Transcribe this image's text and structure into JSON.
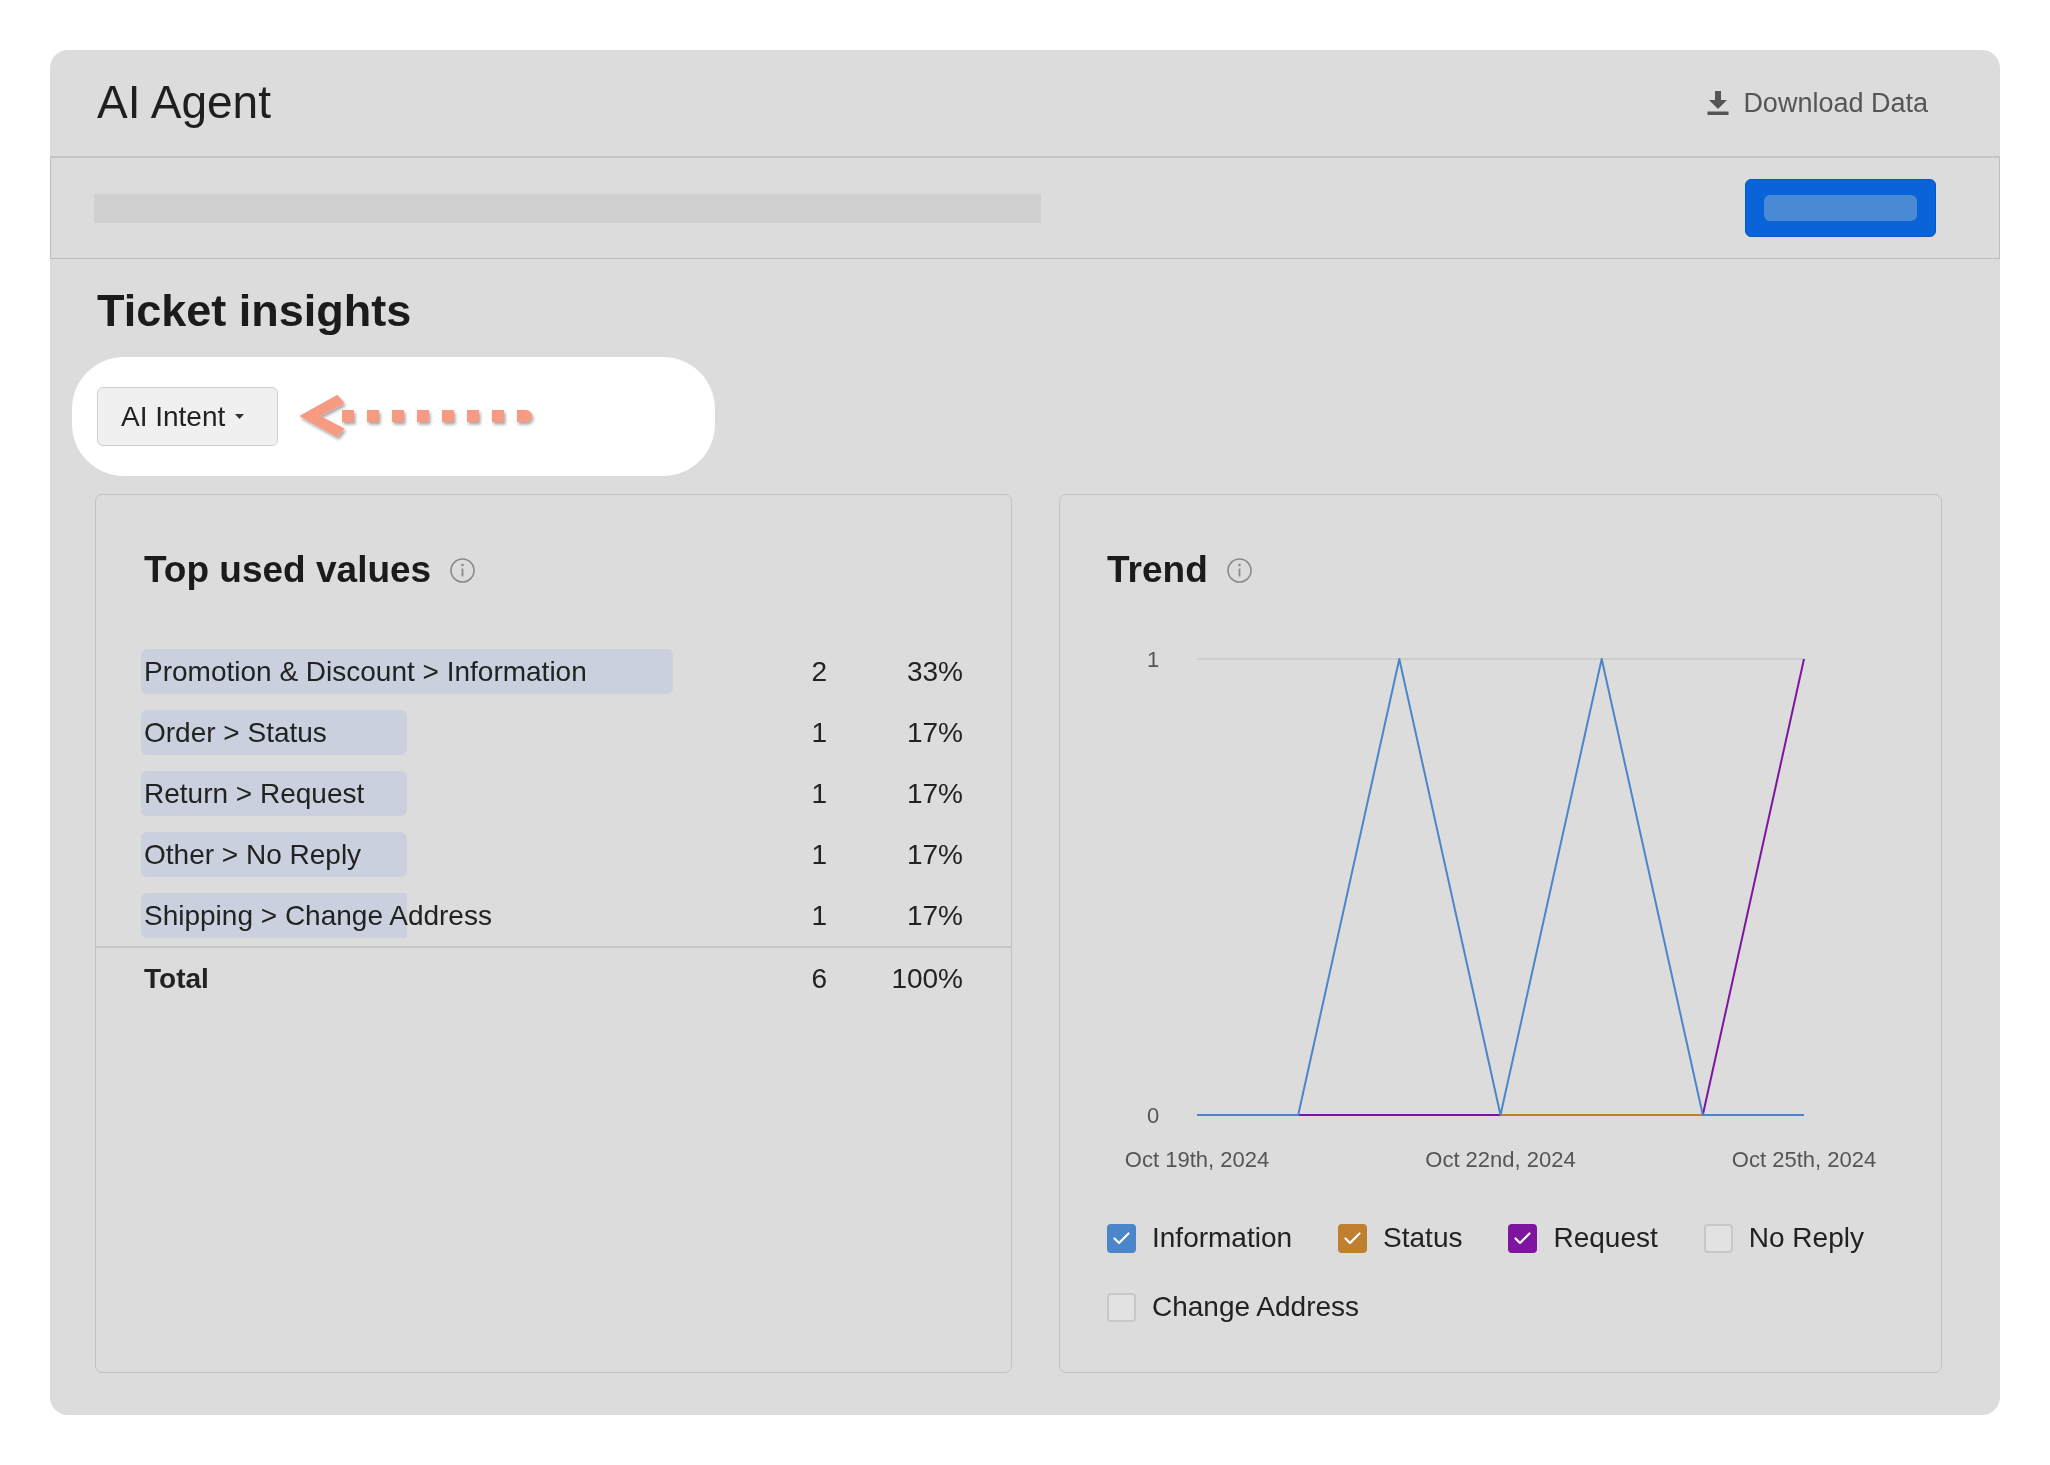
{
  "header": {
    "title": "AI Agent",
    "download_label": "Download Data"
  },
  "section_title": "Ticket insights",
  "intent_dropdown": {
    "label": "AI Intent"
  },
  "top_used_values": {
    "title": "Top used values",
    "rows": [
      {
        "label": "Promotion & Discount > Information",
        "count": "2",
        "percent": "33%"
      },
      {
        "label": "Order > Status",
        "count": "1",
        "percent": "17%"
      },
      {
        "label": "Return > Request",
        "count": "1",
        "percent": "17%"
      },
      {
        "label": "Other > No Reply",
        "count": "1",
        "percent": "17%"
      },
      {
        "label": "Shipping > Change Address",
        "count": "1",
        "percent": "17%"
      }
    ],
    "total": {
      "label": "Total",
      "count": "6",
      "percent": "100%"
    }
  },
  "trend": {
    "title": "Trend",
    "chart_data": {
      "type": "line",
      "categories": [
        "Oct 19th, 2024",
        null,
        null,
        "Oct 22nd, 2024",
        null,
        null,
        "Oct 25th, 2024"
      ],
      "ylim": [
        0,
        1
      ],
      "yticks": [
        0,
        1
      ],
      "series": [
        {
          "color": "#4a86c8",
          "values": [
            0,
            0,
            1,
            0,
            1,
            0,
            0
          ]
        },
        {
          "color": "#c07f2e",
          "values": [
            null,
            null,
            null,
            0,
            0,
            0,
            null
          ]
        },
        {
          "color": "#7f14a0",
          "values": [
            null,
            0,
            0,
            0,
            0,
            0,
            1
          ]
        }
      ]
    },
    "legend": [
      {
        "label": "Information",
        "checked": true,
        "color": "#4a86c8"
      },
      {
        "label": "Status",
        "checked": true,
        "color": "#c07f2e"
      },
      {
        "label": "Request",
        "checked": true,
        "color": "#7f14a0"
      },
      {
        "label": "No Reply",
        "checked": false
      },
      {
        "label": "Change Address",
        "checked": false
      }
    ]
  }
}
